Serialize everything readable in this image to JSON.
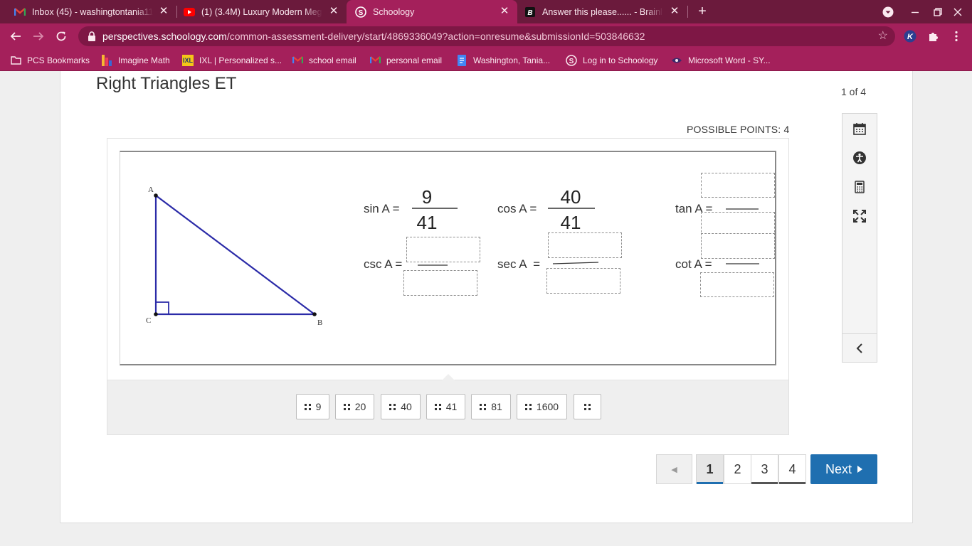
{
  "browser": {
    "tabs": [
      {
        "title": "Inbox (45) - washingtontania11@",
        "icon": "gmail-icon",
        "active": false
      },
      {
        "title": "(1) (3.4M) Luxury Modern Mega M",
        "icon": "youtube-icon",
        "active": false
      },
      {
        "title": "Schoology",
        "icon": "schoology-icon",
        "active": true
      },
      {
        "title": "Answer this please...... - Brainly.c",
        "icon": "brainly-icon",
        "active": false
      }
    ],
    "url_host": "perspectives.schoology.com",
    "url_path": "/common-assessment-delivery/start/4869336049?action=onresume&submissionId=503846632",
    "bookmarks": [
      {
        "label": "PCS Bookmarks",
        "icon": "folder-icon"
      },
      {
        "label": "Imagine Math",
        "icon": "imagine-math-icon"
      },
      {
        "label": "IXL | Personalized s...",
        "icon": "ixl-icon"
      },
      {
        "label": "school email",
        "icon": "gmail-icon"
      },
      {
        "label": "personal email",
        "icon": "gmail-icon"
      },
      {
        "label": "Washington, Tania...",
        "icon": "docs-icon"
      },
      {
        "label": "Log in to Schoology",
        "icon": "schoology-icon"
      },
      {
        "label": "Microsoft Word - SY...",
        "icon": "eye-icon"
      }
    ]
  },
  "assessment": {
    "title": "Right Triangles ET",
    "counter": "1 of 4",
    "points": "POSSIBLE POINTS: 4"
  },
  "figure": {
    "vertices": {
      "a": "A",
      "b": "B",
      "c": "C"
    },
    "sin_label": "sin A =",
    "sin_num": "9",
    "sin_den": "41",
    "cos_label": "cos A =",
    "cos_num": "40",
    "cos_den": "41",
    "tan_label": "tan A =",
    "csc_label": "csc A =",
    "sec_label": "sec A  =",
    "cot_label": "cot A ="
  },
  "answer_bank": [
    "9",
    "20",
    "40",
    "41",
    "81",
    "1600",
    ""
  ],
  "pagination": {
    "prev": "◀",
    "pages": [
      "1",
      "2",
      "3",
      "4"
    ],
    "current": "1",
    "next": "Next"
  },
  "colors": {
    "chrome_dark": "#6b1a3c",
    "chrome": "#a4205b",
    "triangle": "#2b2ba8",
    "primary": "#1f6fb0"
  }
}
